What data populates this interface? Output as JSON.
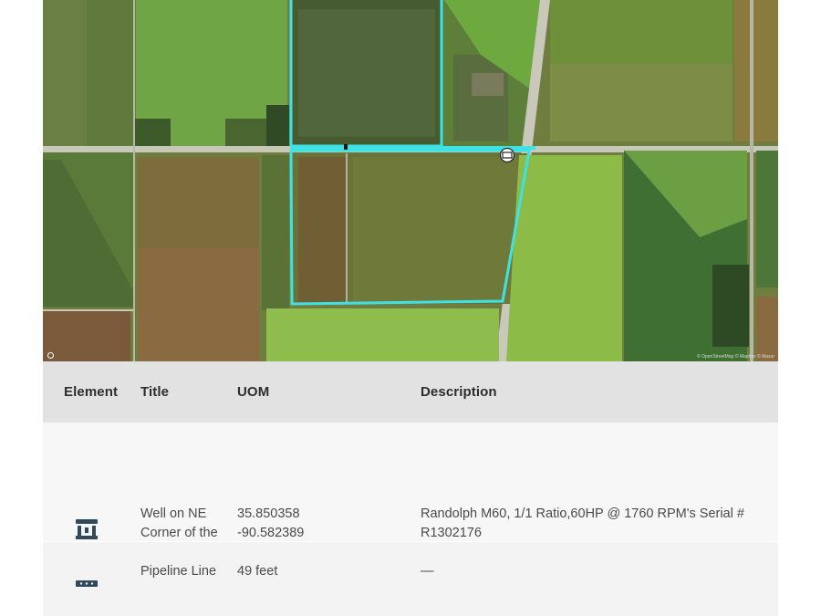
{
  "map": {
    "attribution": "© OpenStreetMap © Mapbox © Maxar",
    "icons": [
      "well-marker-icon",
      "info-icon"
    ],
    "colors": {
      "boundary": "#3fe2e4"
    }
  },
  "table": {
    "headers": {
      "element": "Element",
      "title": "Title",
      "uom": "UOM",
      "description": "Description"
    },
    "rows": [
      {
        "icon": "well-icon",
        "title": "Well on NE Corner of the South tract",
        "uom_line1": "35.850358",
        "uom_line2": "-90.582389",
        "description": "Randolph M60, 1/1 Ratio,60HP @ 1760 RPM's Serial # R1302176"
      },
      {
        "icon": "pipeline-icon",
        "title": "Pipeline Line",
        "uom_line1": "49 feet",
        "description": "—"
      }
    ]
  }
}
